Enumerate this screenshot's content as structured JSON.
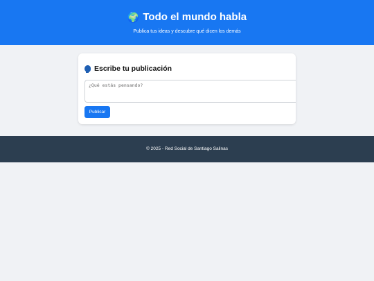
{
  "header": {
    "icon": "globe-icon",
    "title": "Todo el mundo habla",
    "subtitle": "Publica tus ideas y descubre qué dicen los demás"
  },
  "post_card": {
    "icon": "speaking-head-icon",
    "title": "Escribe tu publicación",
    "textarea_placeholder": "¿Qué estás pensando?",
    "textarea_value": "",
    "publish_label": "Publicar"
  },
  "footer": {
    "text": "© 2025 - Red Social de Santiago Salinas"
  },
  "colors": {
    "header_bg": "#1877f2",
    "page_bg": "#f0f2f5",
    "button_bg": "#1877f2",
    "footer_bg": "#2c3e50"
  }
}
